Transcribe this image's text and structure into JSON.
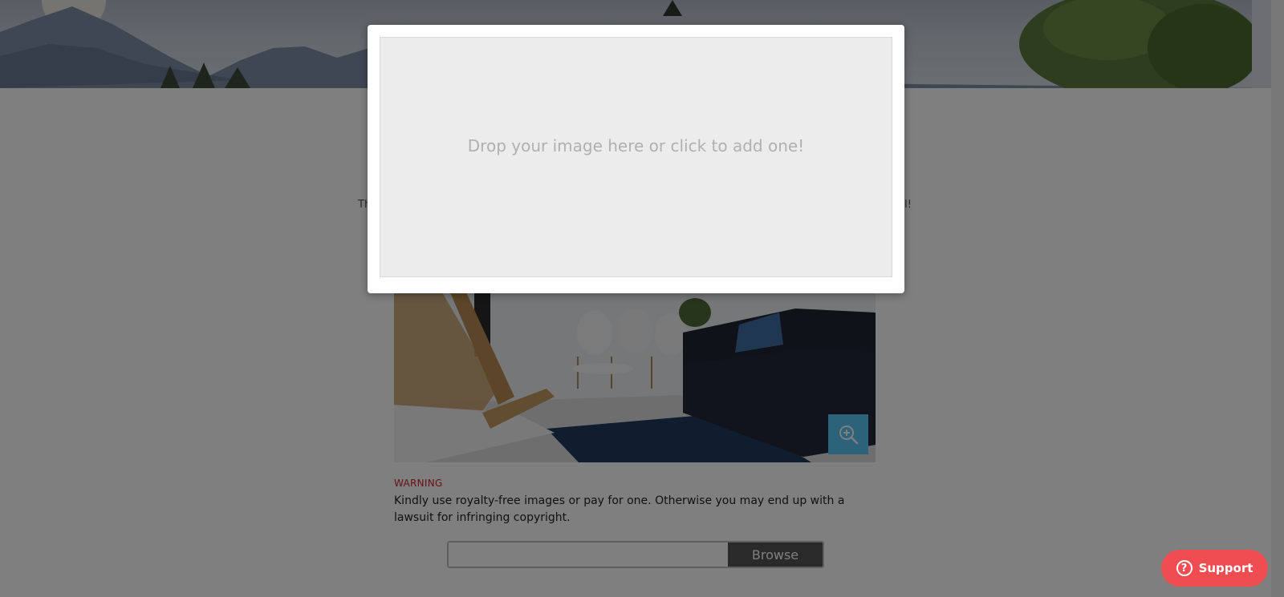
{
  "background": {
    "intro_left_fragment": "Th",
    "intro_right_fragment": "al!",
    "warning": {
      "title": "WARNING",
      "body": "Kindly use royalty-free images or pay for one. Otherwise you may end up with a lawsuit for infringing copyright."
    },
    "file_upload": {
      "value": "",
      "browse_label": "Browse"
    },
    "zoom_icon": "zoom-in-icon"
  },
  "modal": {
    "dropzone_text": "Drop your image here or click to add one!"
  },
  "support": {
    "label": "Support",
    "icon_glyph": "?"
  },
  "colors": {
    "support": "#f04d53",
    "warning": "#d3202f",
    "zoom_button": "#5bc6f5",
    "overlay": "rgba(0,0,0,0.5)"
  }
}
